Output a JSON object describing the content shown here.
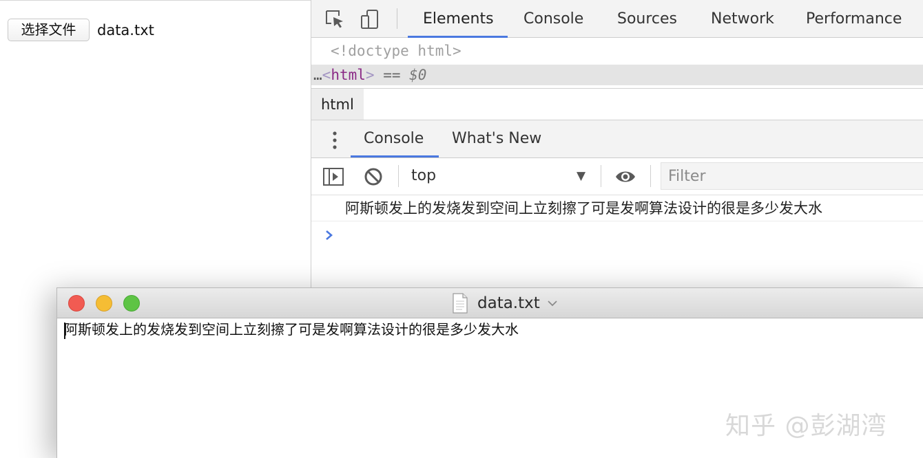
{
  "page": {
    "file_button_label": "选择文件",
    "file_name": "data.txt"
  },
  "devtools": {
    "tabs": [
      {
        "label": "Elements",
        "active": true
      },
      {
        "label": "Console",
        "active": false
      },
      {
        "label": "Sources",
        "active": false
      },
      {
        "label": "Network",
        "active": false
      },
      {
        "label": "Performance",
        "active": false
      }
    ],
    "code": {
      "line1": "<!doctype html>",
      "line2_prefix": "…",
      "tag_open": "<",
      "tag_name": "html",
      "tag_close": ">",
      "eq": " == ",
      "var": "$0"
    },
    "breadcrumb": "html",
    "drawer_tabs": [
      {
        "label": "Console",
        "active": true
      },
      {
        "label": "What's New",
        "active": false
      }
    ],
    "console": {
      "context": "top",
      "filter_placeholder": "Filter",
      "log_message": "阿斯顿发上的发烧发到空间上立刻擦了可是发啊算法设计的很是多少发大水"
    },
    "accent_color": "#4a78e0"
  },
  "textedit": {
    "title": "data.txt",
    "content": "阿斯顿发上的发烧发到空间上立刻擦了可是发啊算法设计的很是多少发大水"
  },
  "watermark": "知乎 @彭湖湾"
}
